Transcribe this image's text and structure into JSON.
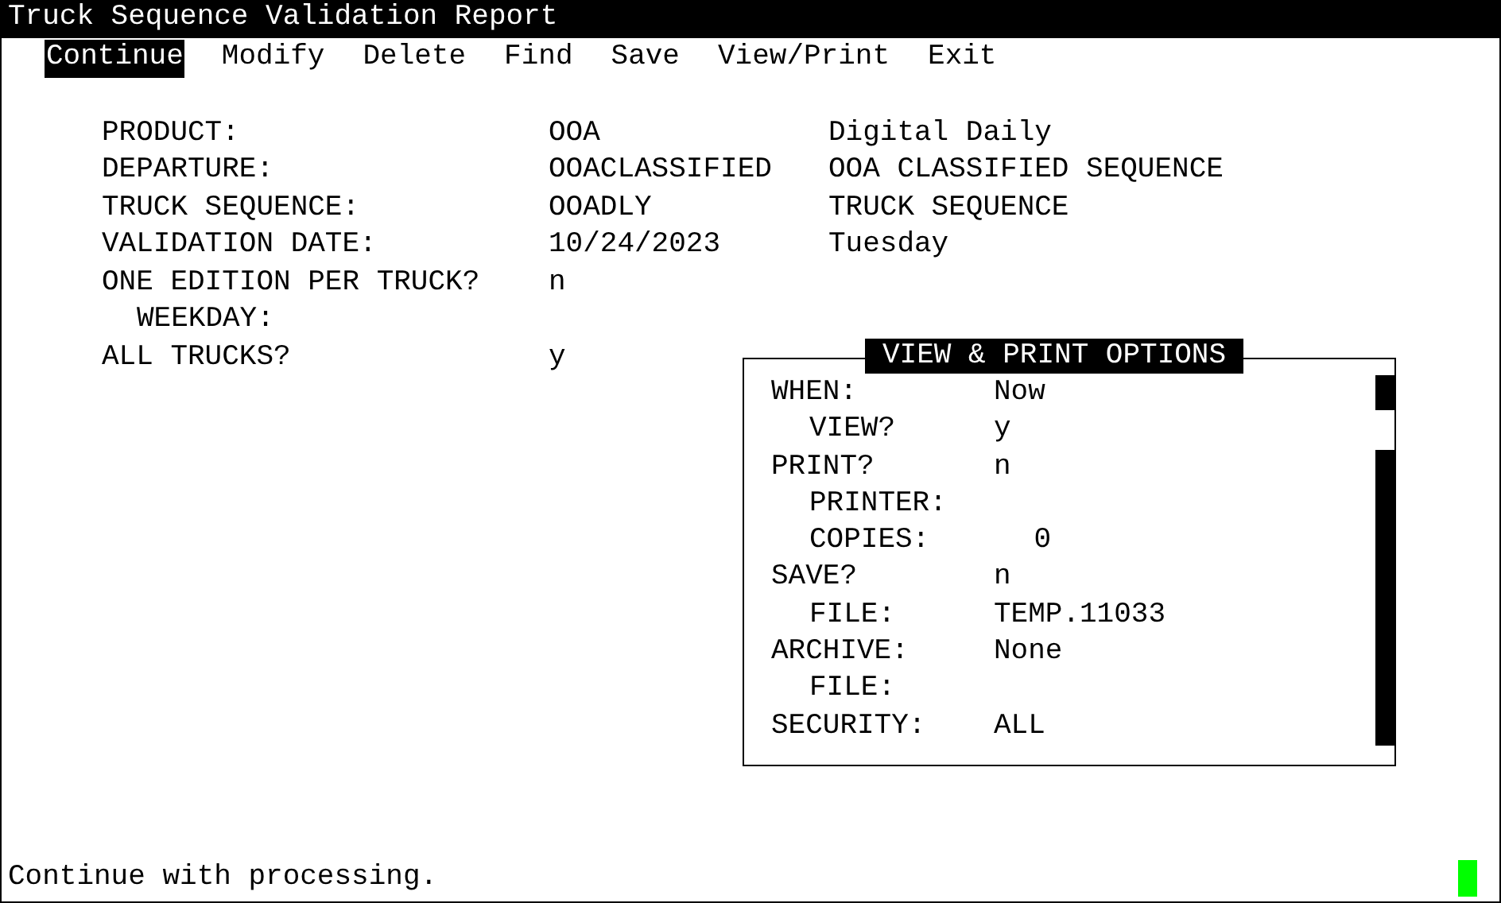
{
  "window": {
    "title": "Truck Sequence Validation Report"
  },
  "menu": [
    {
      "label": "Continue",
      "selected": true
    },
    {
      "label": "Modify",
      "selected": false
    },
    {
      "label": "Delete",
      "selected": false
    },
    {
      "label": "Find",
      "selected": false
    },
    {
      "label": "Save",
      "selected": false
    },
    {
      "label": "View/Print",
      "selected": false
    },
    {
      "label": "Exit",
      "selected": false
    }
  ],
  "fields": [
    {
      "label": "PRODUCT:",
      "value": "OOA",
      "description": "Digital Daily"
    },
    {
      "label": "DEPARTURE:",
      "value": "OOACLASSIFIED",
      "description": "OOA CLASSIFIED SEQUENCE"
    },
    {
      "label": "TRUCK SEQUENCE:",
      "value": "OOADLY",
      "description": "TRUCK SEQUENCE"
    },
    {
      "label": "VALIDATION DATE:",
      "value": "10/24/2023",
      "description": "Tuesday"
    },
    {
      "label": "ONE EDITION PER TRUCK?",
      "value": "n",
      "children": [
        {
          "label": "WEEKDAY:"
        }
      ]
    },
    {
      "label": "ALL TRUCKS?",
      "value": "y"
    }
  ],
  "options_dialog": {
    "title": "VIEW & PRINT OPTIONS",
    "rows": [
      {
        "label": "WHEN:",
        "value": "Now",
        "children": [
          {
            "label": "VIEW?",
            "value": "y"
          }
        ]
      },
      {
        "label": "PRINT?",
        "value": "n",
        "children": [
          {
            "label": "PRINTER:"
          },
          {
            "label": "COPIES:",
            "value": "0",
            "kind": "number"
          }
        ]
      },
      {
        "label": "SAVE?",
        "value": "n",
        "children": [
          {
            "label": "FILE:",
            "value": "TEMP.11033"
          }
        ]
      },
      {
        "label": "ARCHIVE:",
        "value": "None",
        "children": [
          {
            "label": "FILE:"
          }
        ]
      },
      {
        "label": "SECURITY:",
        "value": "ALL"
      }
    ]
  },
  "status_bar": {
    "message": "Continue with processing."
  }
}
